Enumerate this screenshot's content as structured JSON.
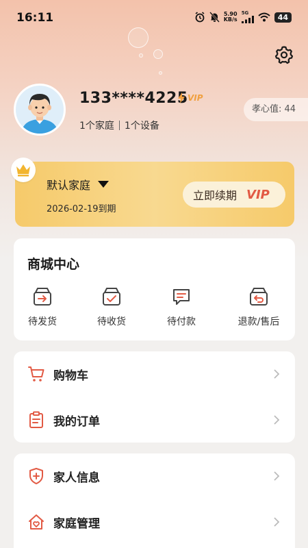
{
  "status_bar": {
    "time": "16:11",
    "speed_value": "5.90",
    "speed_unit": "KB/s",
    "network": "5G",
    "battery": "44"
  },
  "header": {
    "settings_icon": "gear-icon"
  },
  "profile": {
    "phone": "133****4225",
    "vip_label": "VIP",
    "family_count": "1个家庭",
    "device_count": "1个设备",
    "filial_value": "孝心值: 44"
  },
  "vip_card": {
    "family_name": "默认家庭",
    "expiry": "2026-02-19到期",
    "renew_label": "立即续期",
    "vip_label": "VIP"
  },
  "mall": {
    "title": "商城中心",
    "items": [
      {
        "label": "待发货",
        "icon": "box-arrow-icon"
      },
      {
        "label": "待收货",
        "icon": "box-check-icon"
      },
      {
        "label": "待付款",
        "icon": "message-pay-icon"
      },
      {
        "label": "退款/售后",
        "icon": "box-return-icon"
      }
    ]
  },
  "menu1": [
    {
      "label": "购物车",
      "icon": "cart-icon"
    },
    {
      "label": "我的订单",
      "icon": "clipboard-icon"
    }
  ],
  "menu2": [
    {
      "label": "家人信息",
      "icon": "shield-plus-icon"
    },
    {
      "label": "家庭管理",
      "icon": "home-heart-icon"
    }
  ],
  "colors": {
    "accent_red": "#e25a44",
    "vip_gold": "#f6ca6a",
    "icon_gray": "#555555"
  }
}
